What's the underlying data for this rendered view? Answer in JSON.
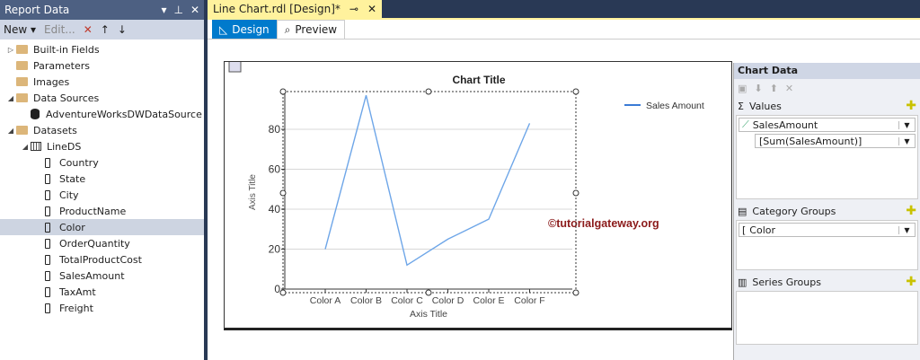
{
  "report_data": {
    "title": "Report Data",
    "toolbar": {
      "new": "New",
      "edit": "Edit..."
    },
    "tree": [
      {
        "label": "Built-in Fields",
        "type": "folder",
        "level": 0,
        "arrow": "▷"
      },
      {
        "label": "Parameters",
        "type": "folder",
        "level": 0,
        "arrow": ""
      },
      {
        "label": "Images",
        "type": "folder",
        "level": 0,
        "arrow": ""
      },
      {
        "label": "Data Sources",
        "type": "folder",
        "level": 0,
        "arrow": "◢"
      },
      {
        "label": "AdventureWorksDWDataSource",
        "type": "db",
        "level": 1,
        "arrow": ""
      },
      {
        "label": "Datasets",
        "type": "folder",
        "level": 0,
        "arrow": "◢"
      },
      {
        "label": "LineDS",
        "type": "table",
        "level": 1,
        "arrow": "◢"
      },
      {
        "label": "Country",
        "type": "field",
        "level": 2
      },
      {
        "label": "State",
        "type": "field",
        "level": 2
      },
      {
        "label": "City",
        "type": "field",
        "level": 2
      },
      {
        "label": "ProductName",
        "type": "field",
        "level": 2
      },
      {
        "label": "Color",
        "type": "field",
        "level": 2,
        "selected": true
      },
      {
        "label": "OrderQuantity",
        "type": "field",
        "level": 2
      },
      {
        "label": "TotalProductCost",
        "type": "field",
        "level": 2
      },
      {
        "label": "SalesAmount",
        "type": "field",
        "level": 2
      },
      {
        "label": "TaxAmt",
        "type": "field",
        "level": 2
      },
      {
        "label": "Freight",
        "type": "field",
        "level": 2
      }
    ]
  },
  "document": {
    "tab": "Line Chart.rdl [Design]*",
    "views": {
      "design": "Design",
      "preview": "Preview"
    }
  },
  "watermark": "©tutorialgateway.org",
  "chart_data": {
    "type": "line",
    "title": "Chart Title",
    "xlabel": "Axis Title",
    "ylabel": "Axis Title",
    "categories": [
      "Color A",
      "Color B",
      "Color C",
      "Color D",
      "Color E",
      "Color F"
    ],
    "series": [
      {
        "name": "Sales Amount",
        "values": [
          20,
          97,
          12,
          25,
          35,
          83
        ],
        "color": "#6ea6e8"
      }
    ],
    "ylim": [
      0,
      98
    ],
    "yticks": [
      0,
      20,
      40,
      60,
      80
    ],
    "legend": "top-right",
    "grid": true
  },
  "chart_data_panel": {
    "title": "Chart Data",
    "values_label": "Values",
    "value_field": "SalesAmount",
    "value_expr": "[Sum(SalesAmount)]",
    "category_label": "Category Groups",
    "category_field": "Color",
    "series_label": "Series Groups"
  }
}
